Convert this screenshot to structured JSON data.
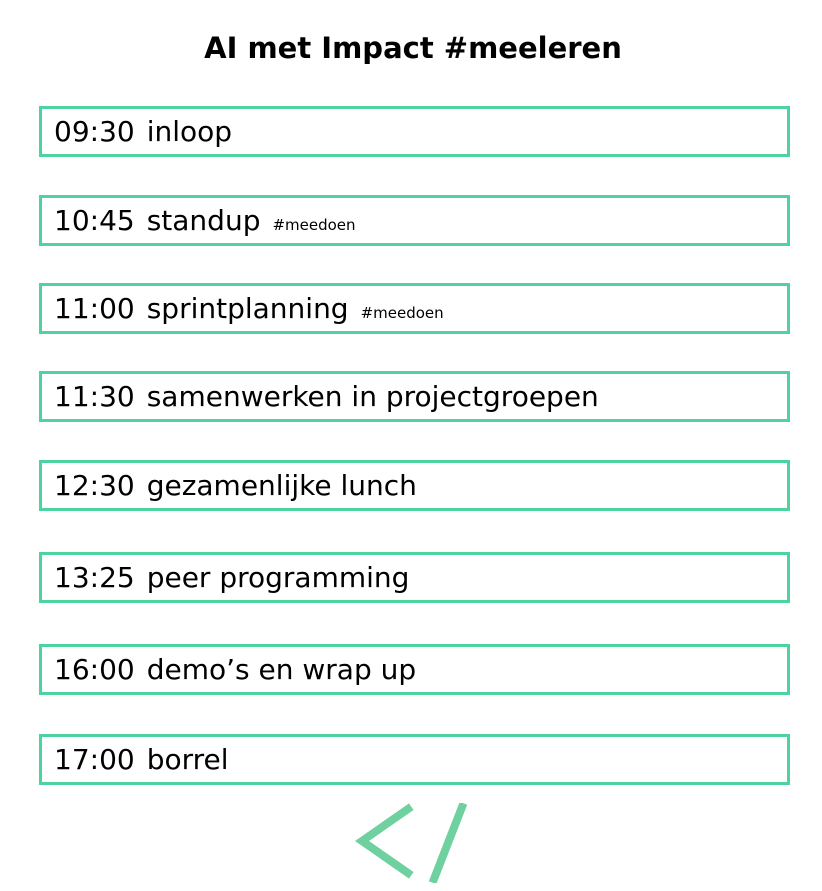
{
  "title": "AI met Impact #meeleren",
  "agenda": [
    {
      "time": "09:30",
      "activity": "inloop",
      "tag": ""
    },
    {
      "time": "10:45",
      "activity": "standup",
      "tag": "#meedoen"
    },
    {
      "time": "11:00",
      "activity": "sprintplanning",
      "tag": "#meedoen"
    },
    {
      "time": "11:30",
      "activity": "samenwerken in projectgroepen",
      "tag": ""
    },
    {
      "time": "12:30",
      "activity": "gezamenlijke lunch",
      "tag": ""
    },
    {
      "time": "13:25",
      "activity": "peer programming",
      "tag": ""
    },
    {
      "time": "16:00",
      "activity": "demo’s en wrap up",
      "tag": ""
    },
    {
      "time": "17:00",
      "activity": "borrel",
      "tag": ""
    }
  ],
  "colors": {
    "accent": "#4cd3a0",
    "logo": "#6fd0a0",
    "text": "#000000",
    "background": "#ffffff"
  },
  "logo": {
    "icon": "code-bracket-icon"
  }
}
